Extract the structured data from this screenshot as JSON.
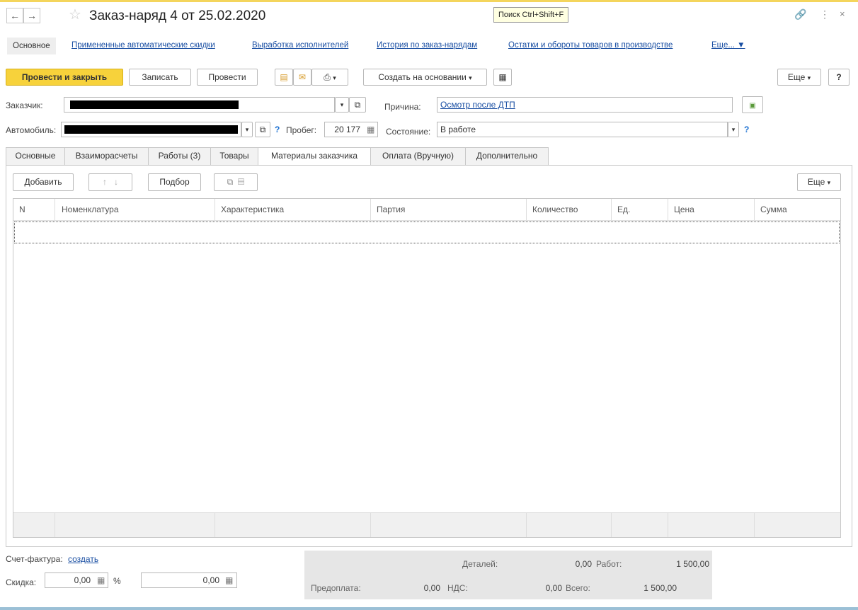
{
  "window": {
    "title": "Заказ-наряд 4 от 25.02.2020",
    "search_hint": "Поиск Ctrl+Shift+F",
    "back_icon": "arrow-left-icon",
    "forward_icon": "arrow-right-icon"
  },
  "links": {
    "active": "Основное",
    "items": [
      "Примененные автоматические скидки",
      "Выработка исполнителей",
      "История по заказ-нарядам",
      "Остатки и обороты товаров в производстве",
      "Еще... ▼"
    ]
  },
  "toolbar": {
    "post_close": "Провести и закрыть",
    "save": "Записать",
    "post": "Провести",
    "create_based": "Создать на основании",
    "more": "Еще",
    "help": "?"
  },
  "form": {
    "customer_label": "Заказчик:",
    "reason_label": "Причина:",
    "reason_value": "Осмотр после ДТП",
    "car_label": "Автомобиль:",
    "mileage_label": "Пробег:",
    "mileage_value": "20 177",
    "state_label": "Состояние:",
    "state_value": "В работе",
    "help_mark": "?"
  },
  "tabs": [
    "Основные",
    "Взаиморасчеты",
    "Работы (3)",
    "Товары",
    "Материалы заказчика",
    "Оплата (Вручную)",
    "Дополнительно"
  ],
  "table_toolbar": {
    "add": "Добавить",
    "pick": "Подбор",
    "more": "Еще"
  },
  "table": {
    "columns": [
      "N",
      "Номенклатура",
      "Характеристика",
      "Партия",
      "Количество",
      "Ед.",
      "Цена",
      "Сумма"
    ]
  },
  "footer": {
    "invoice_label": "Счет-фактура:",
    "invoice_link": "создать",
    "discount_label": "Скидка:",
    "discount_value": "0,00",
    "percent": "%",
    "discount_sum": "0,00",
    "details_label": "Деталей:",
    "details_value": "0,00",
    "works_label": "Работ:",
    "works_value": "1 500,00",
    "prepay_label": "Предоплата:",
    "prepay_value": "0,00",
    "vat_label": "НДС:",
    "vat_value": "0,00",
    "total_label": "Всего:",
    "total_value": "1 500,00"
  },
  "colors": {
    "primary": "#f7d23b",
    "link": "#1a4fa3"
  }
}
